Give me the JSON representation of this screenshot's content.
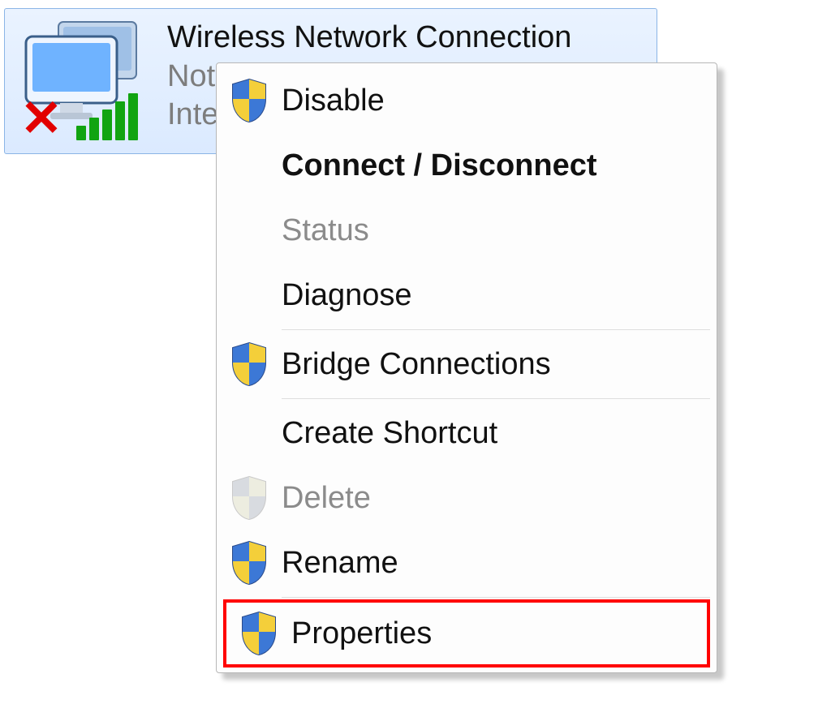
{
  "adapter": {
    "title": "Wireless Network Connection",
    "status_visible": "Not c",
    "device_visible": "Intel(R"
  },
  "menu": {
    "disable": "Disable",
    "connect": "Connect / Disconnect",
    "status": "Status",
    "diagnose": "Diagnose",
    "bridge": "Bridge Connections",
    "shortcut": "Create Shortcut",
    "delete": "Delete",
    "rename": "Rename",
    "properties": "Properties"
  }
}
